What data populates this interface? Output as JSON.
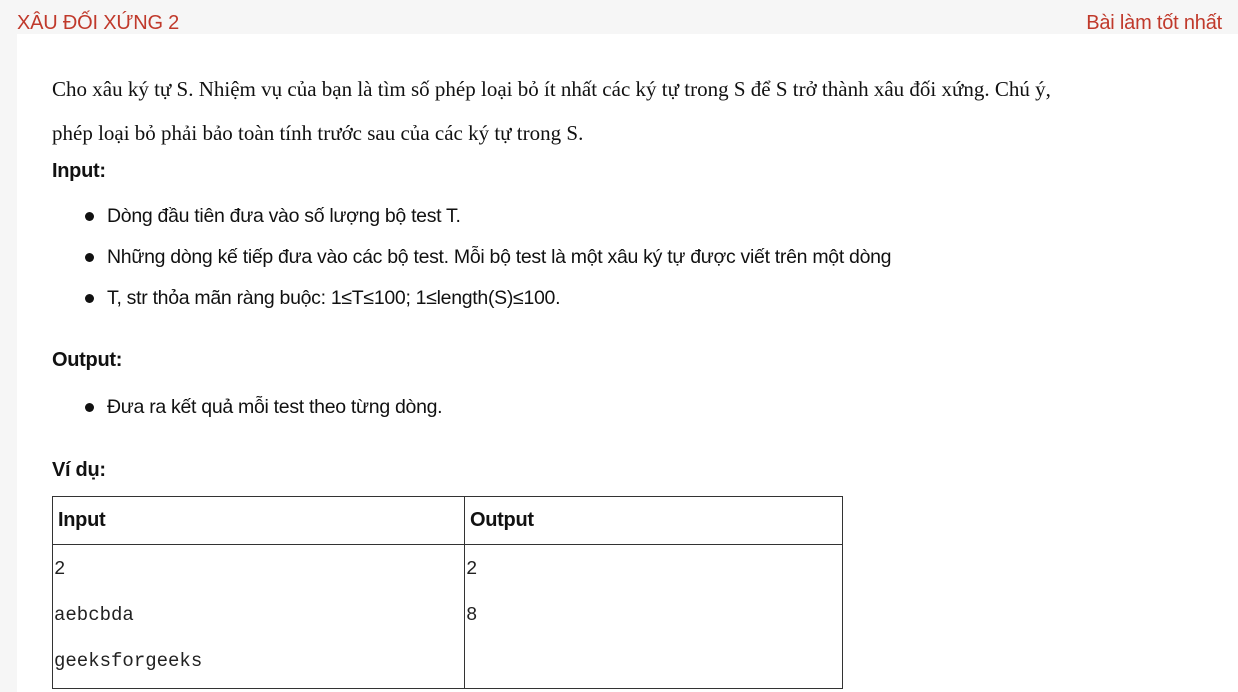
{
  "header": {
    "title": "XÂU ĐỐI XỨNG 2",
    "best_link": "Bài làm tốt nhất"
  },
  "problem": {
    "description_line1": "Cho xâu ký tự S. Nhiệm vụ của bạn là tìm số phép loại bỏ ít nhất các ký tự trong S để S trở thành xâu đối xứng. Chú ý,",
    "description_line2": "phép loại bỏ phải bảo toàn tính trước sau của các ký tự trong S.",
    "input_heading": "Input:",
    "input_items": [
      "Dòng đầu tiên đưa vào số lượng bộ test T.",
      "Những dòng kế tiếp đưa vào các bộ test. Mỗi bộ test là một xâu ký tự được viết trên một dòng",
      "T, str thỏa mãn ràng buộc: 1≤T≤100;  1≤length(S)≤100."
    ],
    "output_heading": "Output:",
    "output_items": [
      "Đưa ra kết quả mỗi test theo từng dòng."
    ],
    "example_heading": "Ví dụ:"
  },
  "example_table": {
    "headers": [
      "Input",
      "Output"
    ],
    "input_lines": [
      "2",
      "aebcbda",
      "geeksforgeeks"
    ],
    "output_lines": [
      "2",
      "8"
    ]
  }
}
